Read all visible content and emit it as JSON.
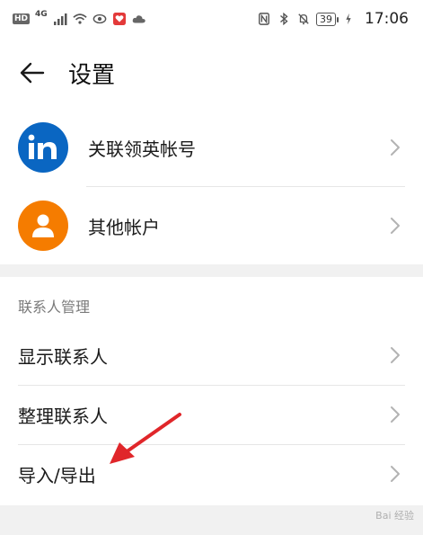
{
  "status_bar": {
    "hd_badge": "HD",
    "network": "4G",
    "battery": "39",
    "time": "17:06"
  },
  "header": {
    "title": "设置"
  },
  "accounts": [
    {
      "label": "关联领英帐号",
      "icon": "linkedin-icon",
      "color": "#0a66c2"
    },
    {
      "label": "其他帐户",
      "icon": "person-icon",
      "color": "#f57c00"
    }
  ],
  "contacts_section": {
    "title": "联系人管理",
    "items": [
      {
        "label": "显示联系人"
      },
      {
        "label": "整理联系人"
      },
      {
        "label": "导入/导出"
      }
    ]
  },
  "annotation": {
    "arrow_color": "#e0262a"
  },
  "watermark": "Bai 经验"
}
